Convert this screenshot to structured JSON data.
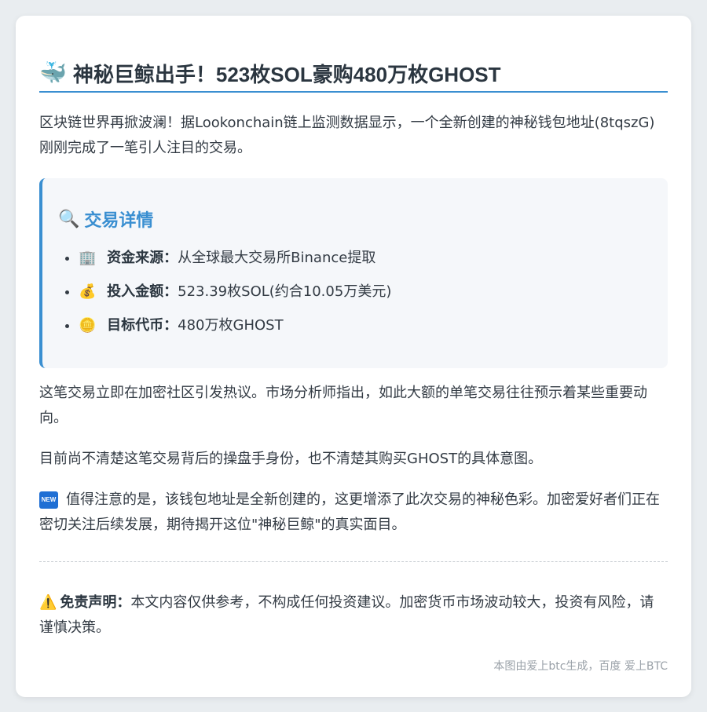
{
  "article": {
    "title_emoji": "🐳",
    "title": "神秘巨鲸出手！523枚SOL豪购480万枚GHOST",
    "intro": "区块链世界再掀波澜！据Lookonchain链上监测数据显示，一个全新创建的神秘钱包地址(8tqszG)刚刚完成了一笔引人注目的交易。",
    "details": {
      "heading_emoji": "🔍",
      "heading": "交易详情",
      "items": [
        {
          "emoji": "🏢",
          "label": "资金来源：",
          "value": "从全球最大交易所Binance提取"
        },
        {
          "emoji": "💰",
          "label": "投入金额：",
          "value": "523.39枚SOL(约合10.05万美元)"
        },
        {
          "emoji": "🪙",
          "label": "目标代币：",
          "value": "480万枚GHOST"
        }
      ]
    },
    "paragraph_2": "这笔交易立即在加密社区引发热议。市场分析师指出，如此大额的单笔交易往往预示着某些重要动向。",
    "paragraph_3": "目前尚不清楚这笔交易背后的操盘手身份，也不清楚其购买GHOST的具体意图。",
    "paragraph_4_badge": "NEW",
    "paragraph_4": "值得注意的是，该钱包地址是全新创建的，这更增添了此次交易的神秘色彩。加密爱好者们正在密切关注后续发展，期待揭开这位\"神秘巨鲸\"的真实面目。",
    "disclaimer": {
      "emoji": "⚠️",
      "label": "免责声明：",
      "text": "本文内容仅供参考，不构成任何投资建议。加密货币市场波动较大，投资有风险，请谨慎决策。"
    },
    "footer": "本图由爱上btc生成，百度 爱上BTC"
  },
  "colors": {
    "accent": "#3a8fd1",
    "background": "#e9edf0",
    "card": "#ffffff"
  }
}
